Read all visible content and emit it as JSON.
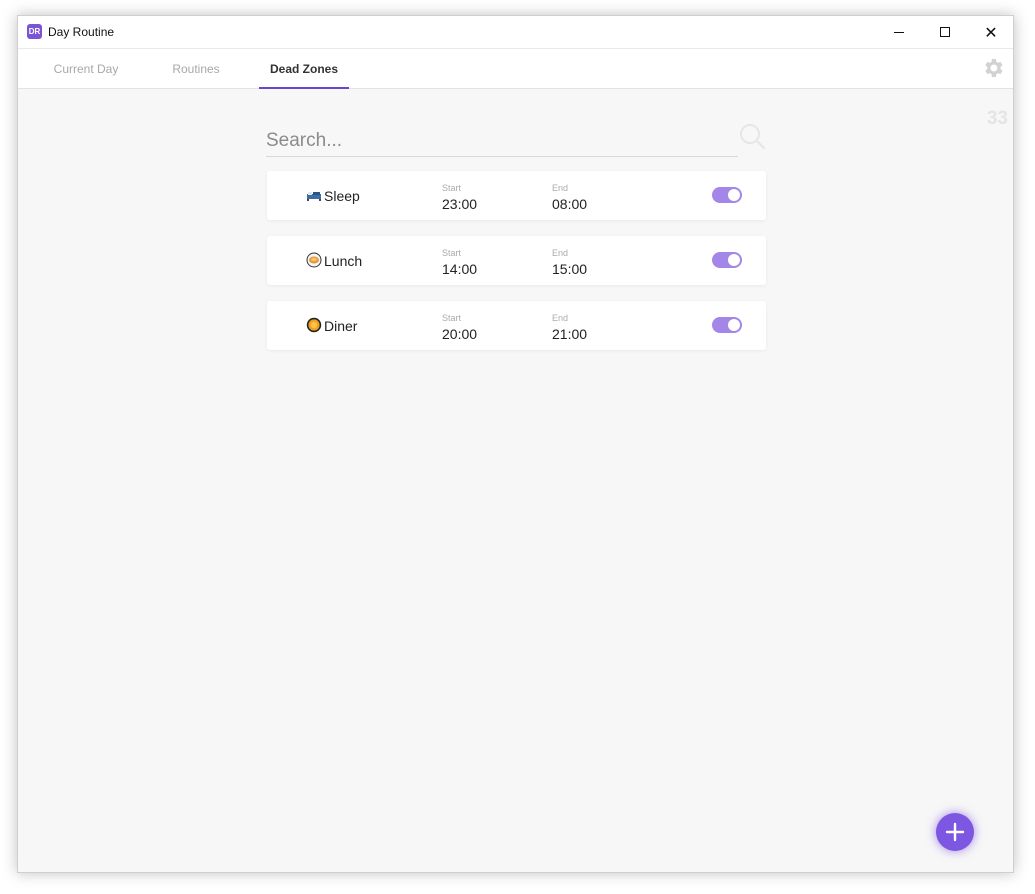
{
  "window": {
    "title": "Day Routine",
    "app_icon_text": "DR"
  },
  "titlebar_buttons": {
    "minimize": "minimize-icon",
    "maximize": "maximize-icon",
    "close": "✕"
  },
  "tabs": [
    {
      "label": "Current Day",
      "active": false
    },
    {
      "label": "Routines",
      "active": false
    },
    {
      "label": "Dead Zones",
      "active": true
    }
  ],
  "settings_icon": "gear-icon",
  "count": "33",
  "search": {
    "placeholder": "Search...",
    "value": ""
  },
  "column_labels": {
    "start": "Start",
    "end": "End"
  },
  "dead_zones": [
    {
      "emoji": "sleeping-bed-icon",
      "name": "Sleep",
      "start": "23:00",
      "end": "08:00",
      "enabled": true
    },
    {
      "emoji": "bento-box-icon",
      "name": "Lunch",
      "start": "14:00",
      "end": "15:00",
      "enabled": true
    },
    {
      "emoji": "food-plate-icon",
      "name": "Diner",
      "start": "20:00",
      "end": "21:00",
      "enabled": true
    }
  ],
  "colors": {
    "accent": "#6a46cf",
    "toggle_on": "#a486e8",
    "fab": "#7d56e2",
    "background": "#f7f7f7"
  },
  "fab": {
    "icon": "plus-icon"
  }
}
